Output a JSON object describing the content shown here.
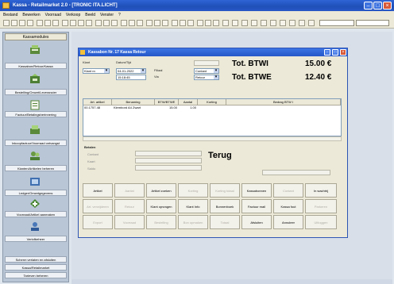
{
  "window": {
    "title": "Kassa - Retailmarket 2.0 - [TRONIC ITA.LICHT]"
  },
  "menu": [
    "Bestand",
    "Bewerken",
    "Voorraad",
    "Verkoop",
    "Beeld",
    "Venster",
    "?"
  ],
  "sidebar": {
    "header": "Kassamodules",
    "items": [
      {
        "label": "Kassabon/Retour/Kassa",
        "icon": "register-icon"
      },
      {
        "label": "Bestelling/Omzet/Leverancier",
        "icon": "order-icon"
      },
      {
        "label": "Factuur/Betalingsherinnering",
        "icon": "invoice-icon"
      },
      {
        "label": "Inkoopfactuur/Voorraad ontvangst",
        "icon": "stock-icon"
      },
      {
        "label": "Klanten/Artikelen beheren",
        "icon": "customers-icon"
      },
      {
        "label": "Ledger/Omzetgegevens",
        "icon": "ledger-icon"
      },
      {
        "label": "Voorraad/Artikel aanmaken",
        "icon": "stock-add-icon"
      },
      {
        "label": "Verlofbeheer",
        "icon": "users-icon"
      }
    ],
    "bottom": [
      "Scherm verlaten en afsluiten",
      "Kassa/Retailmarket",
      "Tarieven beheren"
    ]
  },
  "dialog": {
    "title": "Kassabon Nr. 17 Kassa Retour",
    "labels": {
      "klant": "Klant",
      "datum_tijd": "Datum/Tijd",
      "filiaal": "Filiaal",
      "via": "Via"
    },
    "fields": {
      "klant": "Klant nr.",
      "datum": "04-01-2022",
      "tijd": "15:18:45",
      "f1": "Contant",
      "f2": "Retour"
    },
    "totals": {
      "btwi_label": "Tot. BTWI",
      "btwi_value": "15.00 €",
      "btwe_label": "Tot. BTWE",
      "btwe_value": "12.40 €"
    },
    "grid": {
      "columns": [
        "Art. artikel",
        "Benaming",
        "BTW/BTWE",
        "Aantal",
        "Korting",
        "Bedrag BTW I"
      ],
      "rows": [
        [
          "00.1757.48",
          "Klembord A4 Zwart",
          "15.00",
          "1.00",
          "",
          ""
        ]
      ]
    },
    "bottom_labels": {
      "betalen": "Betalen",
      "contant": "Contant",
      "kaart": "Kaart",
      "saldo": "Saldo"
    },
    "terug": "Terug",
    "buttons": [
      [
        "Artikel",
        "Aantal",
        "Artikel zoeken",
        "Korting",
        "Korting totaal",
        "Kassabonnen",
        "Contant",
        "In wachtrij"
      ],
      [
        "Art. verwijderen",
        "Retour",
        "Klant opvragen",
        "Klant Info",
        "Bonnenboek",
        "Factuur mail",
        "Kassa fout",
        "Parkeren"
      ],
      [
        "Export",
        "Voorraad",
        "Bestelling",
        "Bon opmaken",
        "Totaal",
        "Afsluiten",
        "Annuleer",
        "Uitloggen"
      ]
    ]
  }
}
